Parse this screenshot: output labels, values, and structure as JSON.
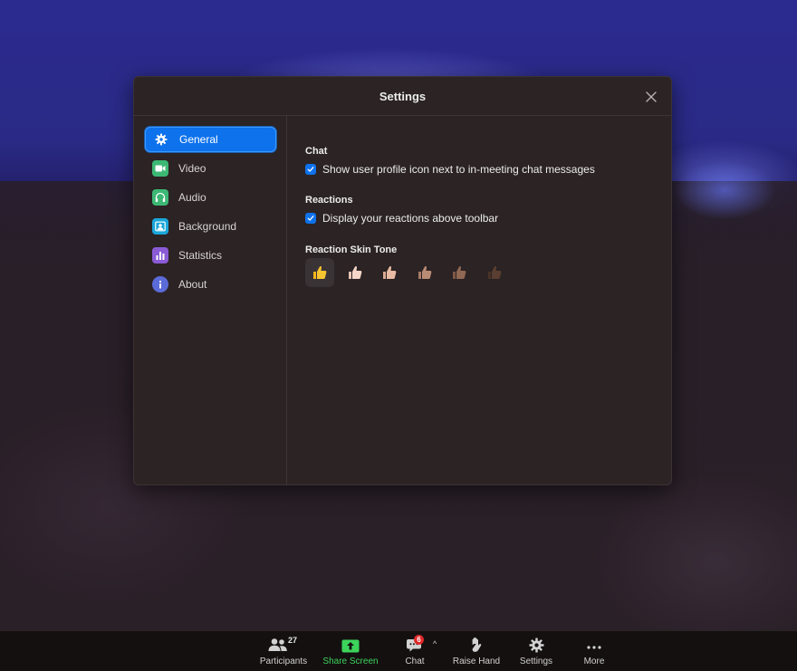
{
  "dialog": {
    "title": "Settings",
    "close_icon": "close-icon"
  },
  "sidebar": {
    "items": [
      {
        "label": "General",
        "icon": "gear-icon",
        "color": "#0e72ed",
        "active": true
      },
      {
        "label": "Video",
        "icon": "video-camera-icon",
        "color": "#3db874"
      },
      {
        "label": "Audio",
        "icon": "headphones-icon",
        "color": "#3db874"
      },
      {
        "label": "Background",
        "icon": "background-icon",
        "color": "#1aa6d8"
      },
      {
        "label": "Statistics",
        "icon": "statistics-icon",
        "color": "#8b5bd6"
      },
      {
        "label": "About",
        "icon": "info-icon",
        "color": "#5b6bd9"
      }
    ]
  },
  "content": {
    "chat": {
      "title": "Chat",
      "option": "Show user profile icon next to in-meeting chat messages",
      "checked": true
    },
    "reactions": {
      "title": "Reactions",
      "option": "Display your reactions above toolbar",
      "checked": true
    },
    "skin_tone": {
      "title": "Reaction Skin Tone",
      "tones": [
        "👍",
        "👍🏻",
        "👍🏼",
        "👍🏽",
        "👍🏾",
        "👍🏿"
      ],
      "selected_index": 0
    }
  },
  "toolbar": {
    "participants": {
      "label": "Participants",
      "count": "27"
    },
    "share": {
      "label": "Share Screen"
    },
    "chat": {
      "label": "Chat",
      "badge": "6"
    },
    "caret": "^",
    "raise_hand": {
      "label": "Raise Hand"
    },
    "settings": {
      "label": "Settings"
    },
    "more": {
      "label": "More"
    }
  },
  "colors": {
    "accent": "#0e72ed",
    "share_green": "#3dd35b",
    "badge_red": "#e02828"
  }
}
